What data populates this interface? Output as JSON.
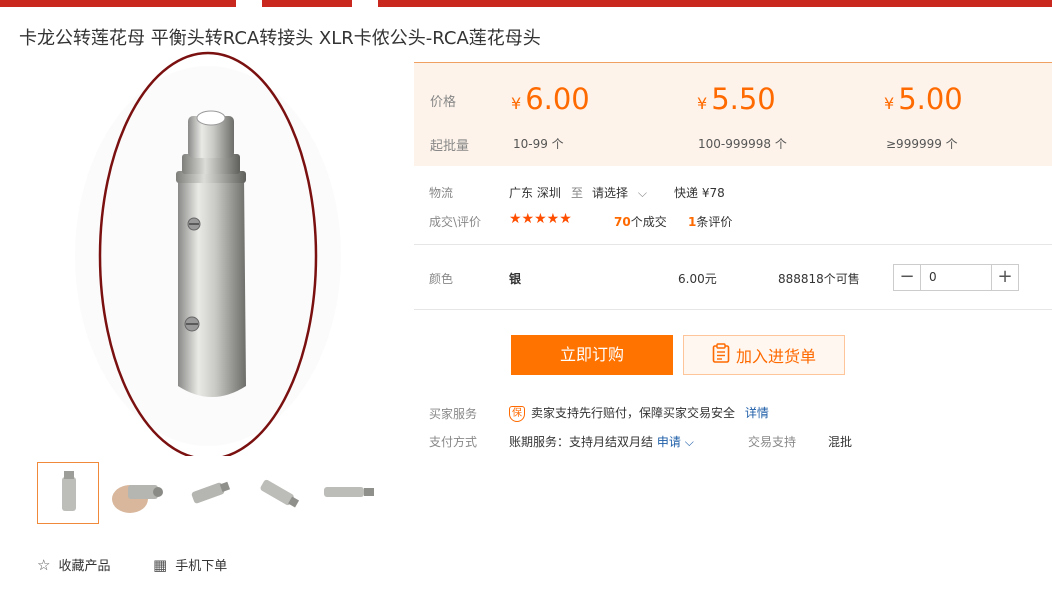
{
  "title": "卡龙公转莲花母 平衡头转RCA转接头 XLR卡侬公头-RCA莲花母头",
  "price": {
    "price_label": "价格",
    "moq_label": "起批量",
    "currency": "¥",
    "tiers": [
      {
        "price": "6.00",
        "qty": "10-99 个"
      },
      {
        "price": "5.50",
        "qty": "100-999998 个"
      },
      {
        "price": "5.00",
        "qty": "≥999999 个"
      }
    ]
  },
  "logistics": {
    "label": "物流",
    "from": "广东 深圳",
    "to_word": "至",
    "select": "请选择",
    "shipping": "快递 ¥78"
  },
  "reviews": {
    "label": "成交\\评价",
    "stars": "★★★★★",
    "deals_count": "70",
    "deals_text": "个成交",
    "review_count": "1",
    "review_text": "条评价"
  },
  "variant": {
    "label": "颜色",
    "name": "银",
    "price": "6.00元",
    "stock": "888818个可售",
    "qty": "0",
    "minus": "−",
    "plus": "+"
  },
  "actions": {
    "buy": "立即订购",
    "cart": "加入进货单"
  },
  "service": {
    "label": "买家服务",
    "badge": "保",
    "text": "卖家支持先行赔付，保障买家交易安全",
    "link": "详情"
  },
  "payment": {
    "label": "支付方式",
    "text": "账期服务：支持月结双月结",
    "link": "申请",
    "trade_label": "交易支持",
    "trade_value": "混批"
  },
  "bottom": {
    "favorite": "收藏产品",
    "mobile": "手机下单"
  },
  "colors": {
    "accent": "#ff6a00",
    "topbar": "#c8281e",
    "annotation_ellipse": "#7a1010"
  },
  "icons": [
    "star-outline-icon",
    "qrcode-icon",
    "shield-icon",
    "clipboard-icon",
    "chevron-down-icon"
  ]
}
